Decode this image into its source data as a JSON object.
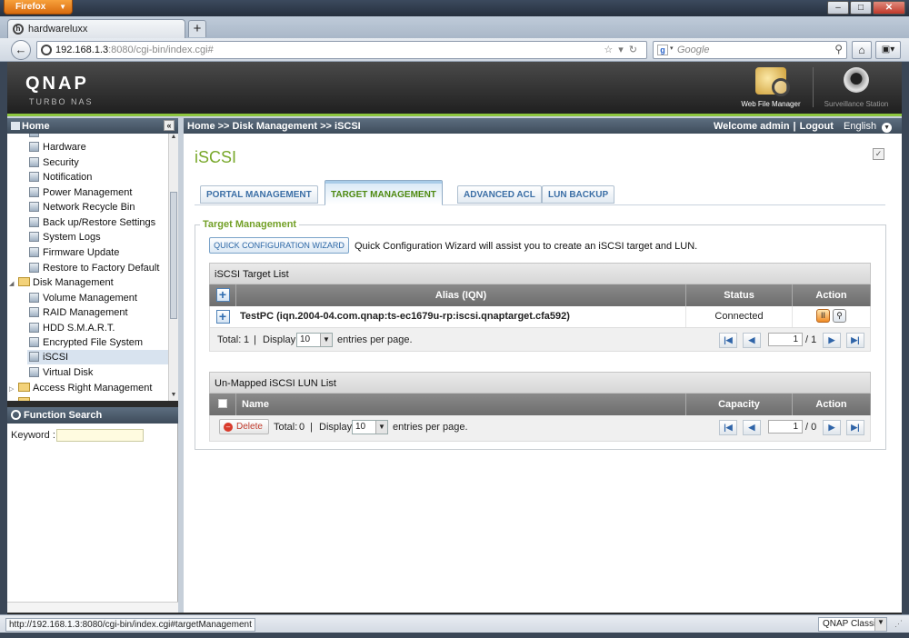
{
  "browser": {
    "app_button": "Firefox",
    "tab_title": "hardwareluxx",
    "new_tab": "+",
    "url_host": "192.168.1.3",
    "url_rest": ":8080/cgi-bin/index.cgi#",
    "search_placeholder": "Google",
    "status_url": "http://192.168.1.3:8080/cgi-bin/index.cgi#targetManagement",
    "theme_select": "QNAP Classic"
  },
  "header": {
    "logo": "QNAP",
    "sublogo": "TURBO NAS",
    "web_file_manager": "Web File Manager",
    "surveillance_station": "Surveillance Station"
  },
  "sidebar": {
    "head": "Home",
    "collapse": "«",
    "items": [
      {
        "label": "Hardware"
      },
      {
        "label": "Security"
      },
      {
        "label": "Notification"
      },
      {
        "label": "Power Management"
      },
      {
        "label": "Network Recycle Bin"
      },
      {
        "label": "Back up/Restore Settings"
      },
      {
        "label": "System Logs"
      },
      {
        "label": "Firmware Update"
      },
      {
        "label": "Restore to Factory Default"
      },
      {
        "label": "Disk Management"
      },
      {
        "label": "Volume Management"
      },
      {
        "label": "RAID Management"
      },
      {
        "label": "HDD S.M.A.R.T."
      },
      {
        "label": "Encrypted File System"
      },
      {
        "label": "iSCSI"
      },
      {
        "label": "Virtual Disk"
      },
      {
        "label": "Access Right Management"
      }
    ],
    "function_search": "Function Search",
    "keyword_label": "Keyword :"
  },
  "topbar": {
    "breadcrumb": "Home >> Disk Management >> iSCSI",
    "welcome": "Welcome admin",
    "sep": "|",
    "logout": "Logout",
    "language": "English"
  },
  "page": {
    "title": "iSCSI",
    "tabs": [
      {
        "label": "PORTAL MANAGEMENT"
      },
      {
        "label": "TARGET MANAGEMENT"
      },
      {
        "label": "ADVANCED ACL"
      },
      {
        "label": "LUN BACKUP"
      }
    ],
    "section_title": "Target Management",
    "wizard_button": "QUICK CONFIGURATION WIZARD",
    "wizard_desc": "Quick Configuration Wizard will assist you to create an iSCSI target and LUN."
  },
  "target_list": {
    "title": "iSCSI Target List",
    "columns": {
      "alias": "Alias (IQN)",
      "status": "Status",
      "action": "Action"
    },
    "rows": [
      {
        "alias": "TestPC (iqn.2004-04.com.qnap:ts-ec1679u-rp:iscsi.qnaptarget.cfa592)",
        "status": "Connected"
      }
    ],
    "total_label": "Total:",
    "total": "1",
    "sep": "|",
    "display_label": "Display",
    "per_page": "10",
    "per_page_suffix": "entries per page.",
    "page": "1",
    "pages": "/ 1"
  },
  "lun_list": {
    "title": "Un-Mapped iSCSI LUN List",
    "columns": {
      "name": "Name",
      "capacity": "Capacity",
      "action": "Action"
    },
    "delete_button": "Delete",
    "total_label": "Total:",
    "total": "0",
    "sep": "|",
    "display_label": "Display",
    "per_page": "10",
    "per_page_suffix": "entries per page.",
    "page": "1",
    "pages": "/ 0"
  }
}
